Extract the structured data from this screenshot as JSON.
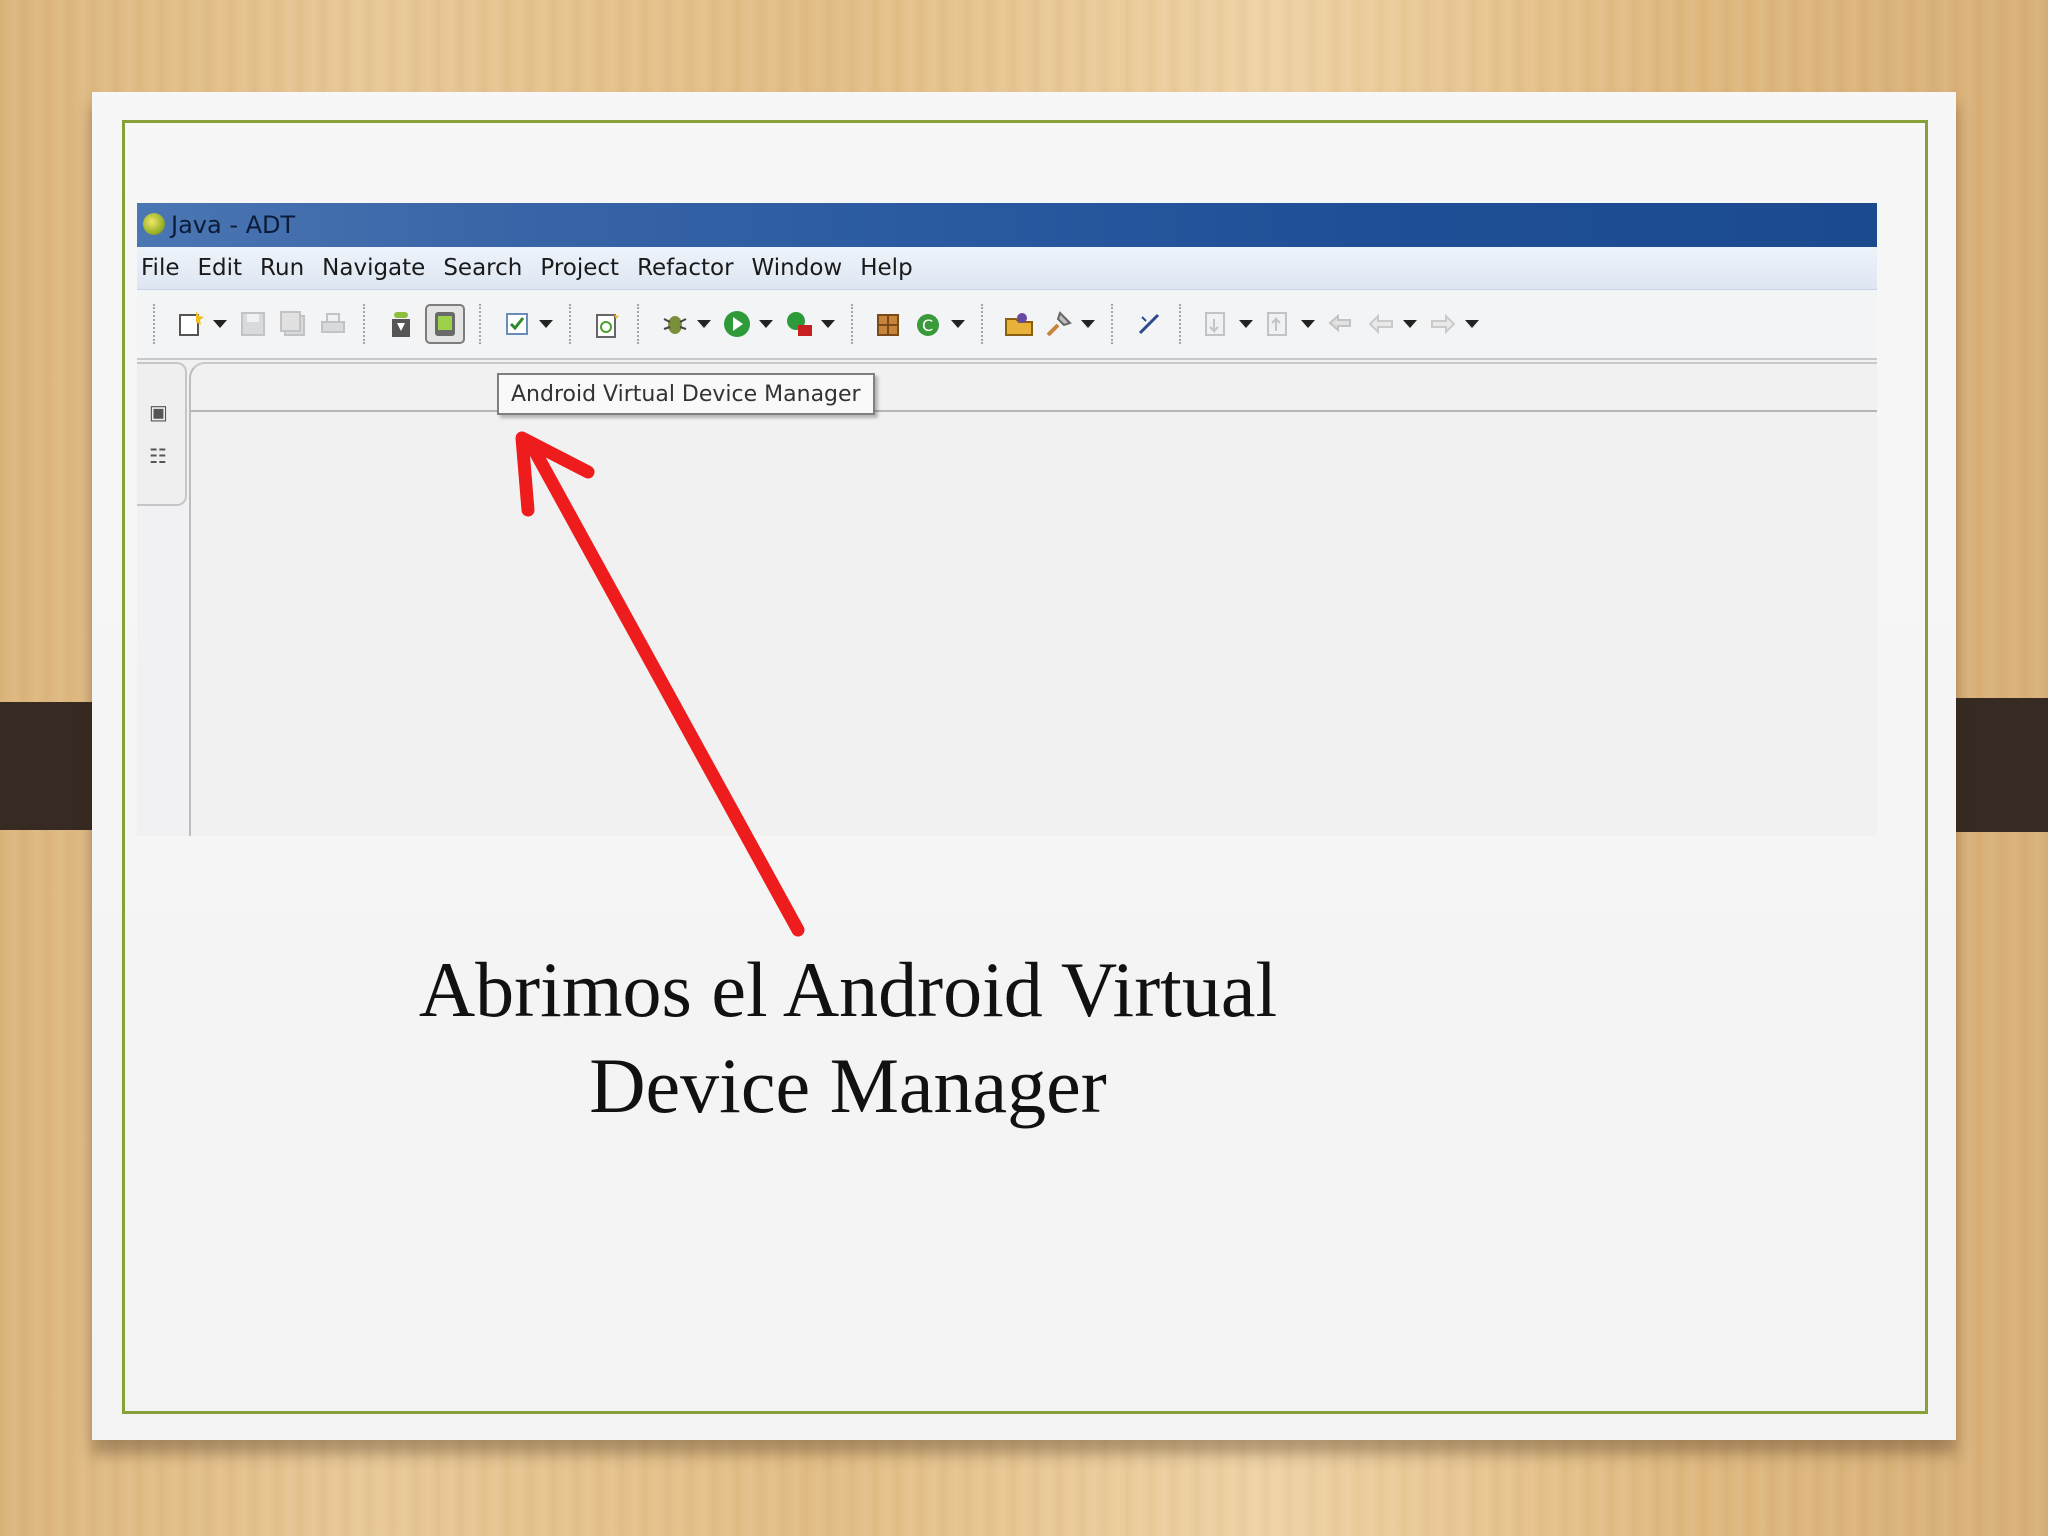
{
  "window": {
    "title": "Java - ADT"
  },
  "menu": [
    "File",
    "Edit",
    "Run",
    "Navigate",
    "Search",
    "Project",
    "Refactor",
    "Window",
    "Help"
  ],
  "toolbar": {
    "icons": [
      "new-wizard-icon",
      "save-icon",
      "save-all-icon",
      "print-icon",
      "android-sdk-manager-icon",
      "android-virtual-device-manager-icon",
      "task-icon",
      "new-android-project-icon",
      "debug-icon",
      "run-icon",
      "external-tools-icon",
      "new-java-package-icon",
      "new-java-class-icon",
      "open-type-icon",
      "search-icon",
      "toggle-mark-occurrences-icon",
      "next-annotation-icon",
      "previous-annotation-icon",
      "last-edit-location-icon",
      "back-icon",
      "forward-icon"
    ]
  },
  "tooltip": "Android Virtual Device Manager",
  "caption": {
    "line1": "Abrimos el Android Virtual",
    "line2": "Device Manager"
  },
  "colors": {
    "slide_border": "#86a03a",
    "arrow": "#ee1c1c",
    "titlebar": "#1f4f96"
  }
}
